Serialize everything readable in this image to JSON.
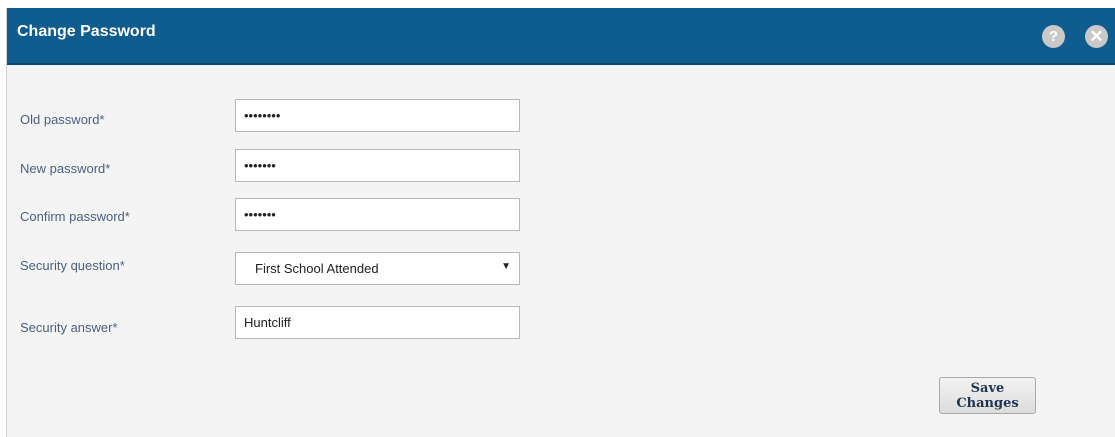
{
  "dialog": {
    "title": "Change Password",
    "help_glyph": "?",
    "close_glyph": "✕"
  },
  "form": {
    "old_password": {
      "label": "Old password*",
      "value": "••••••••"
    },
    "new_password": {
      "label": "New password*",
      "value": "•••••••"
    },
    "confirm_password": {
      "label": "Confirm password*",
      "value": "•••••••"
    },
    "security_question": {
      "label": "Security question*",
      "selected": "First School Attended",
      "arrow": "▼"
    },
    "security_answer": {
      "label": "Security answer*",
      "value": "Huntcliff"
    }
  },
  "actions": {
    "save_label": "Save Changes"
  },
  "colors": {
    "titlebar": "#0f5c8f",
    "label_text": "#4a6182",
    "background": "#f4f4f4"
  }
}
